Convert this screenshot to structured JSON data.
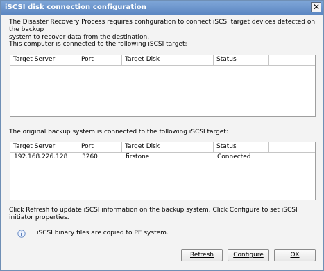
{
  "window": {
    "title": "iSCSI disk connection configuration"
  },
  "intro": "The Disaster Recovery Process requires configuration to connect iSCSI target devices detected on the backup\nsystem to recover data from the destination.",
  "current": {
    "label": "This computer is connected to the following iSCSI target:",
    "columns": [
      "Target Server",
      "Port",
      "Target Disk",
      "Status",
      ""
    ]
  },
  "original": {
    "label": "The original backup system is connected to the following iSCSI target:",
    "columns": [
      "Target Server",
      "Port",
      "Target Disk",
      "Status",
      ""
    ],
    "rows": [
      {
        "server": "192.168.226.128",
        "port": "3260",
        "disk": "firstone",
        "status": "Connected"
      }
    ]
  },
  "help_text": "Click Refresh to update iSCSI information on the backup system. Click Configure to set iSCSI initiator properties.",
  "info_text": "iSCSI binary files are copied to PE system.",
  "buttons": {
    "refresh": "Refresh",
    "configure": "Configure",
    "ok": "OK"
  }
}
